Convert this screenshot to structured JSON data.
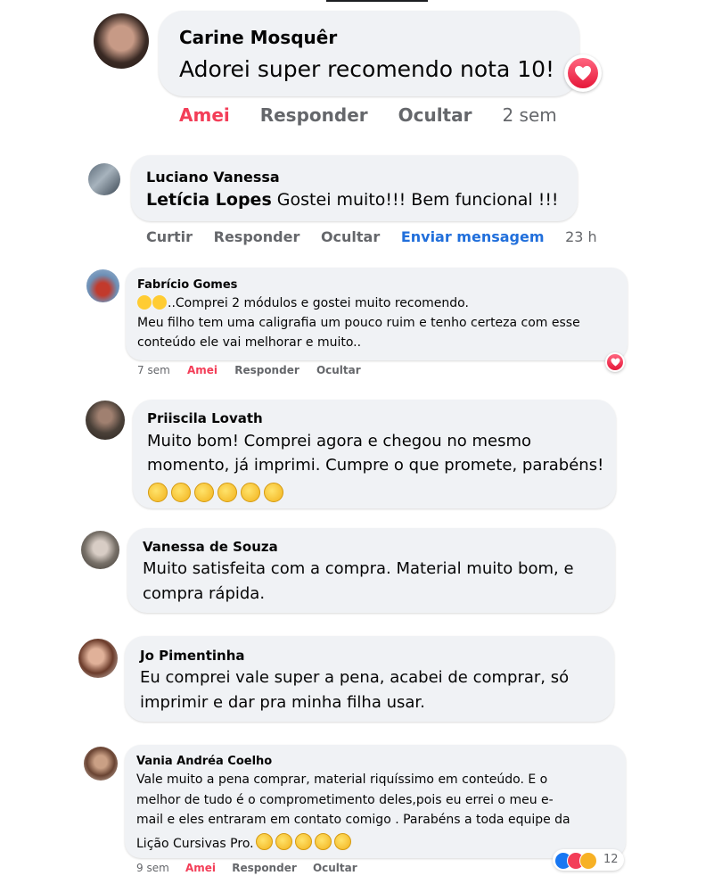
{
  "comments": [
    {
      "name": "Carine Mosquêr",
      "text": "Adorei super recomendo nota 10!",
      "actions": {
        "react": "Amei",
        "reply": "Responder",
        "hide": "Ocultar",
        "time": "2 sem"
      }
    },
    {
      "name": "Luciano Vanessa",
      "mention": "Letícia Lopes",
      "text": " Gostei muito!!! Bem funcional !!!",
      "actions": {
        "react": "Curtir",
        "reply": "Responder",
        "hide": "Ocultar",
        "message": "Enviar mensagem",
        "time": "23 h"
      }
    },
    {
      "name": "Fabrício Gomes",
      "lines": [
        "..Comprei 2 módulos e gostei muito recomendo.",
        "Meu filho tem uma caligrafia um pouco ruim e tenho certeza com esse",
        "conteúdo ele vai melhorar e muito.."
      ],
      "actions": {
        "time": "7 sem",
        "react": "Amei",
        "reply": "Responder",
        "hide": "Ocultar"
      }
    },
    {
      "name": "Priiscila Lovath",
      "lines": [
        "Muito bom! Comprei agora e chegou no mesmo",
        "momento, já imprimi. Cumpre o que promete, parabéns!"
      ]
    },
    {
      "name": "Vanessa de Souza",
      "lines": [
        "Muito satisfeita com a compra. Material muito bom, e",
        "compra rápida."
      ]
    },
    {
      "name": "Jo Pimentinha",
      "lines": [
        "Eu comprei vale super a pena, acabei de comprar, só",
        "imprimir e dar pra minha filha usar."
      ]
    },
    {
      "name": "Vania Andréa Coelho",
      "lines": [
        "Vale muito a pena comprar, material riquíssimo em conteúdo. E o",
        "melhor de tudo é o comprometimento deles,pois eu errei o meu e-",
        "mail e eles entraram em contato comigo . Parabéns a toda equipe da",
        "Lição Cursivas Pro."
      ],
      "actions": {
        "time": "9 sem",
        "react": "Amei",
        "reply": "Responder",
        "hide": "Ocultar"
      },
      "reaction_count": "12"
    }
  ],
  "icons": {
    "heart": "heart-icon",
    "like": "like-icon",
    "wow": "wow-icon",
    "clap": "clapping-hands-icon",
    "star_eyes": "star-struck-emoji-icon"
  },
  "colors": {
    "love": "#f33e58",
    "link": "#216fdb",
    "bubble": "#f0f2f5",
    "muted": "#65676b"
  }
}
